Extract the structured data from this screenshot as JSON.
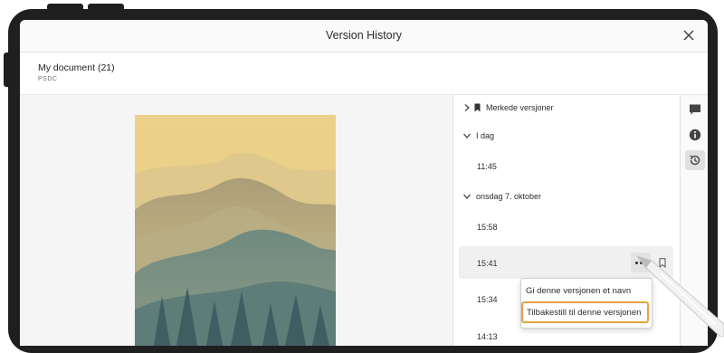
{
  "dialog": {
    "title": "Version History"
  },
  "document": {
    "name": "My document (21)",
    "type": "PSDC"
  },
  "versions": {
    "marked": "Merkede versjoner",
    "group_today": "I dag",
    "today_items": [
      "11:45"
    ],
    "group_date": "onsdag 7. oktober",
    "date_items": [
      "15:58",
      "15:41",
      "15:34",
      "14:13"
    ]
  },
  "context_menu": {
    "items": [
      "Gi denne versjonen et navn",
      "Tilbakestill til denne versjonen"
    ]
  },
  "colors": {
    "highlight_border": "#e8a33d",
    "device_frame": "#1f1f1f"
  },
  "icons": [
    "close-icon",
    "bookmark-icon",
    "chevron-right-icon",
    "chevron-down-icon",
    "more-icon",
    "comment-icon",
    "info-icon",
    "history-icon"
  ]
}
